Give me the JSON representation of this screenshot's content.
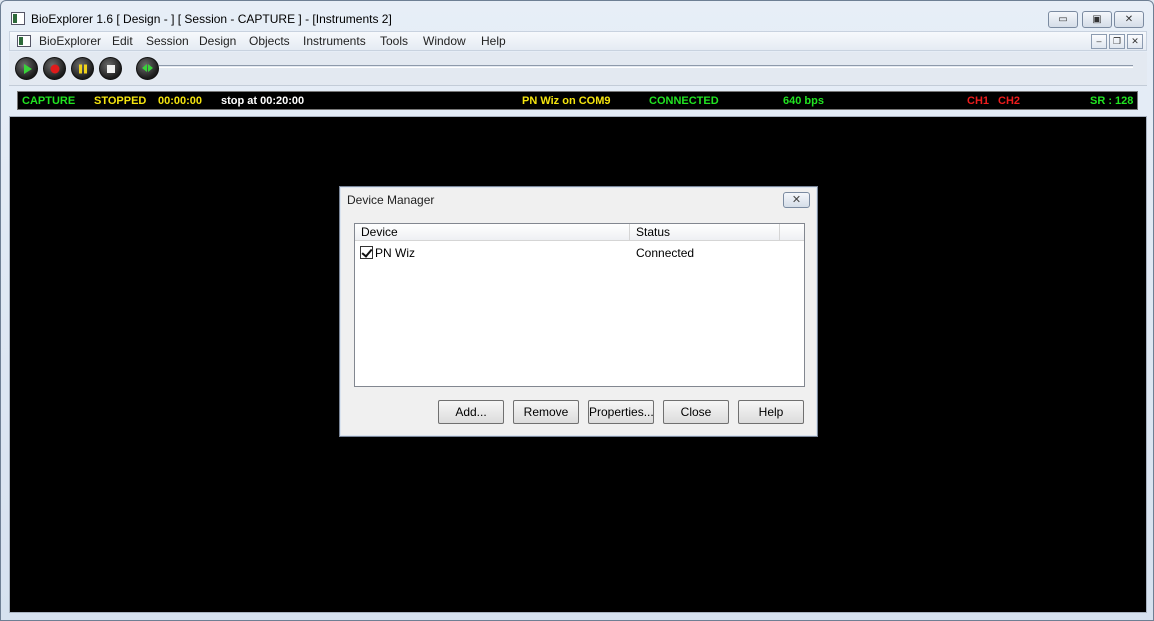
{
  "window": {
    "title": "BioExplorer 1.6  [ Design -  ] [ Session - CAPTURE ] - [Instruments 2]",
    "minimize_symbol": "▭",
    "maximize_symbol": "▣",
    "close_symbol": "✕"
  },
  "menu": {
    "items": [
      "BioExplorer",
      "Edit",
      "Session",
      "Design",
      "Objects",
      "Instruments",
      "Tools",
      "Window",
      "Help"
    ],
    "mdi_minimize_symbol": "–",
    "mdi_restore_symbol": "❐",
    "mdi_close_symbol": "✕"
  },
  "toolbar": {
    "icons": [
      "play-icon",
      "record-icon",
      "pause-icon",
      "stop-icon"
    ],
    "position_slider_icon": "scrub-icon"
  },
  "status": {
    "mode": "CAPTURE",
    "state": "STOPPED",
    "elapsed": "00:00:00",
    "stop_at": "stop at 00:20:00",
    "device_port": "PN Wiz on COM9",
    "connection": "CONNECTED",
    "bitrate": "640 bps",
    "ch1": "CH1",
    "ch2": "CH2",
    "sample_rate": "SR : 128",
    "colors": {
      "green": "#21e321",
      "yellow": "#f4e40e",
      "white": "#ffffff",
      "red": "#ee1c1c"
    }
  },
  "dialog": {
    "title": "Device Manager",
    "close_symbol": "✕",
    "columns": [
      "Device",
      "Status"
    ],
    "rows": [
      {
        "device": "PN Wiz",
        "status": "Connected",
        "checked": true
      }
    ],
    "buttons": {
      "add": "Add...",
      "remove": "Remove",
      "properties": "Properties...",
      "close": "Close",
      "help": "Help"
    }
  }
}
